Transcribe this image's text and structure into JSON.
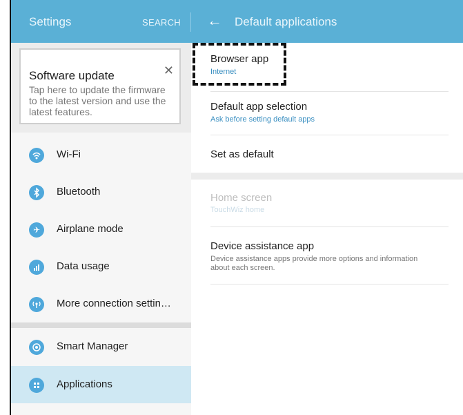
{
  "header": {
    "left_title": "Settings",
    "search_label": "SEARCH",
    "back_icon": "arrow-left-icon",
    "right_title": "Default applications"
  },
  "update_card": {
    "title": "Software update",
    "description": "Tap here to update the firmware to the latest version and use the latest features.",
    "close_icon": "close-icon"
  },
  "sidebar": {
    "items": [
      {
        "label": "Wi-Fi",
        "icon": "wifi-icon"
      },
      {
        "label": "Bluetooth",
        "icon": "bluetooth-icon"
      },
      {
        "label": "Airplane mode",
        "icon": "airplane-icon"
      },
      {
        "label": "Data usage",
        "icon": "data-usage-icon"
      },
      {
        "label": "More connection settin…",
        "icon": "connection-icon"
      },
      {
        "label": "Smart Manager",
        "icon": "smart-manager-icon"
      },
      {
        "label": "Applications",
        "icon": "applications-icon",
        "selected": true
      }
    ]
  },
  "main": {
    "items": [
      {
        "title": "Browser app",
        "subtitle": "Internet"
      },
      {
        "title": "Default app selection",
        "subtitle": "Ask before setting default apps"
      },
      {
        "title": "Set as default"
      },
      {
        "title": "Home screen",
        "subtitle": "TouchWiz home",
        "disabled": true
      },
      {
        "title": "Device assistance app",
        "description": "Device assistance apps provide more options and information about each screen."
      }
    ]
  },
  "colors": {
    "header_bg": "#5ab0d6",
    "accent": "#3a8fc1",
    "selected_bg": "#cfe8f3",
    "icon_bg": "#4fa8db"
  }
}
